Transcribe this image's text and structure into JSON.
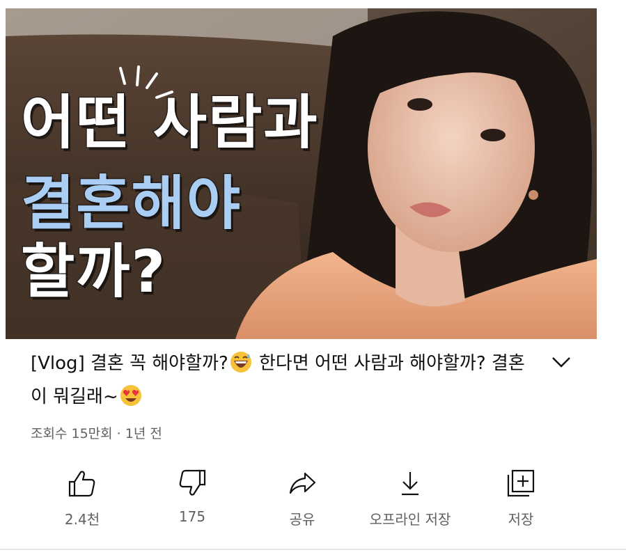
{
  "thumbnail": {
    "line1": "어떤 사람과",
    "line2": "결혼해야",
    "line3": "할까?"
  },
  "video": {
    "title_part1": "[Vlog] 결혼 꼭 해야할까?",
    "title_emoji1": "grinning-sweat-emoji",
    "title_part2": " 한다면 어떤 사람과 해야할까? 결혼이 뭐길래~",
    "title_emoji2": "heart-eyes-emoji",
    "meta": "조회수 15만회 · 1년 전"
  },
  "actions": [
    {
      "icon": "thumbs-up-icon",
      "label": "2.4천"
    },
    {
      "icon": "thumbs-down-icon",
      "label": "175"
    },
    {
      "icon": "share-icon",
      "label": "공유"
    },
    {
      "icon": "download-icon",
      "label": "오프라인 저장"
    },
    {
      "icon": "save-playlist-icon",
      "label": "저장"
    }
  ],
  "colors": {
    "highlight_text": "#a9cdf3",
    "secondary_text": "#606060"
  }
}
